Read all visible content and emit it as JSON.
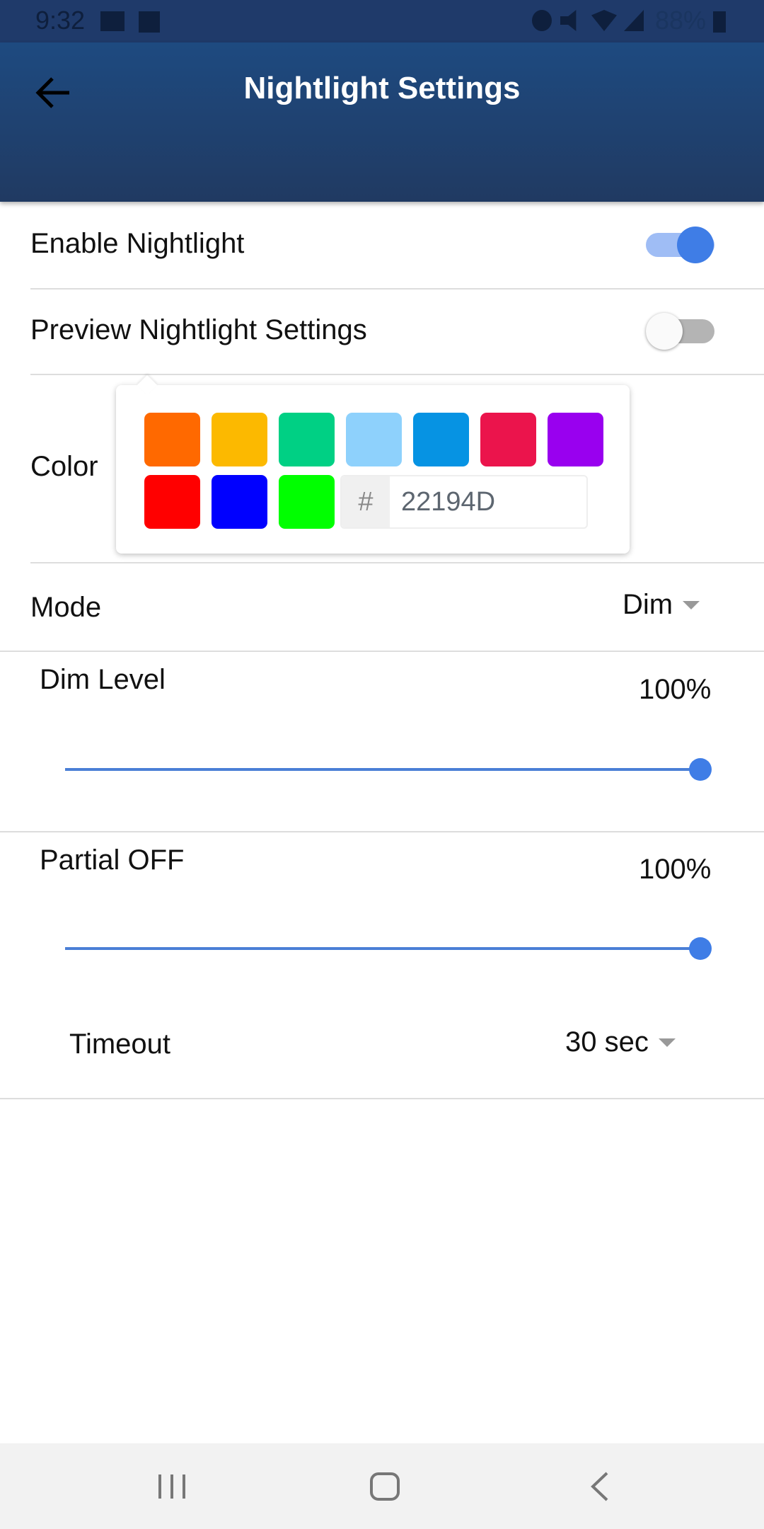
{
  "status_bar": {
    "time": "9:32",
    "battery": "88%",
    "icons": [
      "mail-icon",
      "image-icon",
      "alarm-icon",
      "mute-icon",
      "wifi-icon",
      "signal-icon",
      "battery-charging-icon"
    ]
  },
  "header": {
    "title": "Nightlight Settings",
    "back_icon": "arrow-left-icon"
  },
  "settings": {
    "enable": {
      "label": "Enable Nightlight",
      "on": true
    },
    "preview": {
      "label": "Preview Nightlight Settings",
      "on": false
    },
    "color": {
      "label": "Color",
      "swatches": [
        "#FF6900",
        "#FCB900",
        "#00D084",
        "#8ED1FC",
        "#0693E3",
        "#EB144C",
        "#9900EF",
        "#FF0000",
        "#0000FF",
        "#00FF00"
      ],
      "hash": "#",
      "hex_value": "22194D"
    },
    "mode": {
      "label": "Mode",
      "value": "Dim"
    },
    "dim_level": {
      "label": "Dim Level",
      "value_text": "100%",
      "value": 100
    },
    "partial_off": {
      "label": "Partial OFF",
      "value_text": "100%",
      "value": 100
    },
    "timeout": {
      "label": "Timeout",
      "value": "30 sec"
    }
  },
  "colors": {
    "accent": "#3f7de6",
    "header": "#1e4a80"
  }
}
